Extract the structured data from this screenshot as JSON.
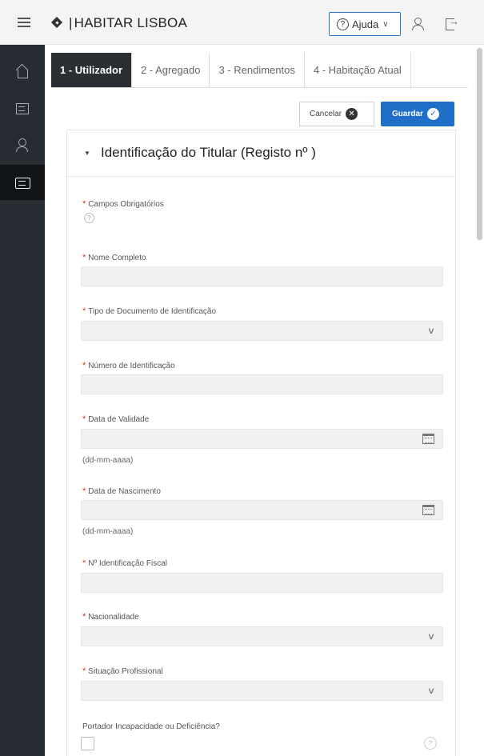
{
  "header": {
    "brand": "HABITAR LISBOA",
    "help_label": "Ajuda"
  },
  "tabs": [
    {
      "label": "1 - Utilizador",
      "active": true
    },
    {
      "label": "2 - Agregado",
      "active": false
    },
    {
      "label": "3 - Rendimentos",
      "active": false
    },
    {
      "label": "4 - Habitação Atual",
      "active": false
    }
  ],
  "actions": {
    "cancel_label": "Cancelar",
    "save_label": "Guardar"
  },
  "region": {
    "title": "Identificação do Titular (Registo nº )"
  },
  "form": {
    "required_note": "Campos Obrigatórios",
    "full_name": {
      "label": "Nome Completo",
      "value": ""
    },
    "doc_type": {
      "label": "Tipo de Documento de Identificação",
      "value": ""
    },
    "doc_number": {
      "label": "Número de Identificação",
      "value": ""
    },
    "expiry_date": {
      "label": "Data de Validade",
      "value": "",
      "hint": "(dd-mm-aaaa)"
    },
    "birth_date": {
      "label": "Data de Nascimento",
      "value": "",
      "hint": "(dd-mm-aaaa)"
    },
    "tax_id": {
      "label": "Nº Identificação Fiscal",
      "value": ""
    },
    "nationality": {
      "label": "Nacionalidade",
      "value": ""
    },
    "professional_status": {
      "label": "Situação Profissional",
      "value": ""
    },
    "disability": {
      "label": "Portador Incapacidade ou Deficiência?",
      "checked": false
    }
  },
  "colors": {
    "primary": "#1f6fc9",
    "nav_bg": "#262c31",
    "required": "#e0322b"
  }
}
